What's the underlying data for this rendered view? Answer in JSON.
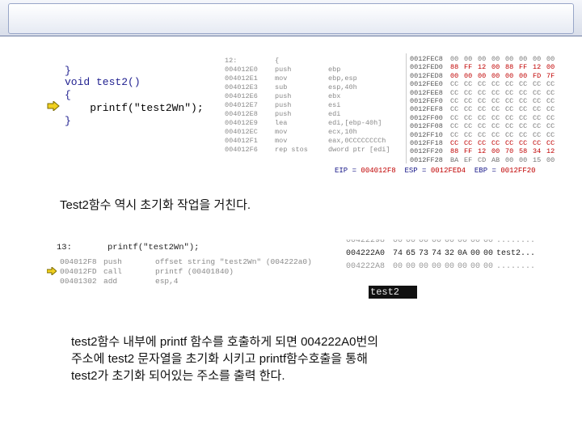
{
  "source": {
    "lines": [
      "}",
      "void test2()",
      "{",
      "    printf(\"test2Wn\");",
      "}"
    ]
  },
  "disasm": {
    "rows": [
      {
        "addr": "12:",
        "mn": "{",
        "op": ""
      },
      {
        "addr": "004012E0",
        "mn": "push",
        "op": "ebp"
      },
      {
        "addr": "004012E1",
        "mn": "mov",
        "op": "ebp,esp"
      },
      {
        "addr": "004012E3",
        "mn": "sub",
        "op": "esp,40h"
      },
      {
        "addr": "004012E6",
        "mn": "push",
        "op": "ebx"
      },
      {
        "addr": "004012E7",
        "mn": "push",
        "op": "esi"
      },
      {
        "addr": "004012E8",
        "mn": "push",
        "op": "edi"
      },
      {
        "addr": "004012E9",
        "mn": "lea",
        "op": "edi,[ebp-40h]"
      },
      {
        "addr": "004012EC",
        "mn": "mov",
        "op": "ecx,10h"
      },
      {
        "addr": "004012F1",
        "mn": "mov",
        "op": "eax,0CCCCCCCCh"
      },
      {
        "addr": "004012F6",
        "mn": "rep stos",
        "op": "dword ptr [edi]"
      }
    ]
  },
  "memory": {
    "rows": [
      {
        "addr": "0012FEC8",
        "bytes": [
          "00",
          "00",
          "00",
          "00",
          "00",
          "00",
          "00",
          "00"
        ],
        "color": "#777777"
      },
      {
        "addr": "0012FED0",
        "bytes": [
          "88",
          "FF",
          "12",
          "00",
          "88",
          "FF",
          "12",
          "00"
        ],
        "color": "#c00000"
      },
      {
        "addr": "0012FED8",
        "bytes": [
          "00",
          "00",
          "00",
          "00",
          "00",
          "00",
          "FD",
          "7F"
        ],
        "color": "#c00000"
      },
      {
        "addr": "0012FEE0",
        "bytes": [
          "CC",
          "CC",
          "CC",
          "CC",
          "CC",
          "CC",
          "CC",
          "CC"
        ],
        "color": "#777777"
      },
      {
        "addr": "0012FEE8",
        "bytes": [
          "CC",
          "CC",
          "CC",
          "CC",
          "CC",
          "CC",
          "CC",
          "CC"
        ],
        "color": "#777777"
      },
      {
        "addr": "0012FEF0",
        "bytes": [
          "CC",
          "CC",
          "CC",
          "CC",
          "CC",
          "CC",
          "CC",
          "CC"
        ],
        "color": "#777777"
      },
      {
        "addr": "0012FEF8",
        "bytes": [
          "CC",
          "CC",
          "CC",
          "CC",
          "CC",
          "CC",
          "CC",
          "CC"
        ],
        "color": "#777777"
      },
      {
        "addr": "0012FF00",
        "bytes": [
          "CC",
          "CC",
          "CC",
          "CC",
          "CC",
          "CC",
          "CC",
          "CC"
        ],
        "color": "#777777"
      },
      {
        "addr": "0012FF08",
        "bytes": [
          "CC",
          "CC",
          "CC",
          "CC",
          "CC",
          "CC",
          "CC",
          "CC"
        ],
        "color": "#777777"
      },
      {
        "addr": "0012FF10",
        "bytes": [
          "CC",
          "CC",
          "CC",
          "CC",
          "CC",
          "CC",
          "CC",
          "CC"
        ],
        "color": "#777777"
      },
      {
        "addr": "0012FF18",
        "bytes": [
          "CC",
          "CC",
          "CC",
          "CC",
          "CC",
          "CC",
          "CC",
          "CC"
        ],
        "color": "#c00000"
      },
      {
        "addr": "0012FF20",
        "bytes": [
          "88",
          "FF",
          "12",
          "00",
          "70",
          "58",
          "34",
          "12"
        ],
        "color": "#c00000"
      },
      {
        "addr": "0012FF28",
        "bytes": [
          "BA",
          "EF",
          "CD",
          "AB",
          "00",
          "00",
          "15",
          "00"
        ],
        "color": "#777777"
      }
    ]
  },
  "registers": {
    "eip_label": "EIP =",
    "eip": "004012F8",
    "esp_label": "ESP =",
    "esp": "0012FED4",
    "ebp_label": "EBP =",
    "ebp": "0012FF20"
  },
  "caption1": "Test2함수 역시 초기화 작업을 거친다.",
  "disasm2": {
    "header": "13:       printf(\"test2Wn\");",
    "rows": [
      {
        "addr": "004012F8",
        "mn": "push",
        "op": "offset string \"test2Wn\" (004222a0)"
      },
      {
        "addr": "004012FD",
        "mn": "call",
        "op": "printf (00401840)"
      },
      {
        "addr": "00401302",
        "mn": "add",
        "op": "esp,4"
      }
    ]
  },
  "memory2": {
    "rows": [
      {
        "addr": "00422298",
        "bytes": [
          "00",
          "00",
          "00",
          "00",
          "00",
          "00",
          "00",
          "00"
        ],
        "ascii": "........",
        "faded": true
      },
      {
        "addr": "004222A0",
        "bytes": [
          "74",
          "65",
          "73",
          "74",
          "32",
          "0A",
          "00",
          "00"
        ],
        "ascii": "test2...",
        "faded": false
      },
      {
        "addr": "004222A8",
        "bytes": [
          "00",
          "00",
          "00",
          "00",
          "00",
          "00",
          "00",
          "00"
        ],
        "ascii": "........",
        "faded": true
      }
    ]
  },
  "output": "test2",
  "caption2": [
    "test2함수 내부에 printf 함수를 호출하게 되면 004222A0번의",
    "주소에 test2 문자열을 초기화 시키고 printf함수호출을 통해",
    "test2가 초기화 되어있는 주소를 출력 한다."
  ],
  "colors": {
    "accent": "#c00000",
    "code_blue": "#1f1f8f",
    "arrow_yellow": "#f0d020"
  },
  "icons": {
    "current-line": "current-line-arrow-icon"
  }
}
